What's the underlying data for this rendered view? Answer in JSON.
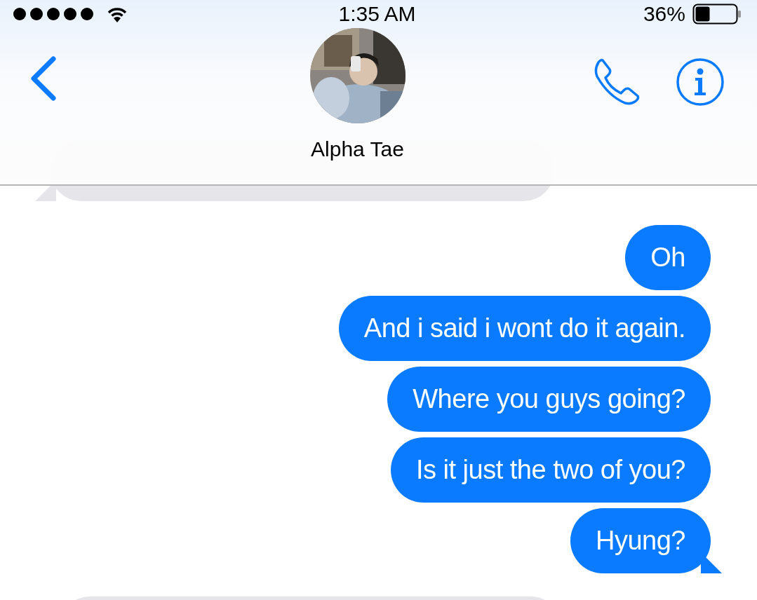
{
  "status_bar": {
    "time": "1:35 AM",
    "battery": "36%"
  },
  "header": {
    "contact_name": "Alpha Tae"
  },
  "messages": [
    {
      "kind": "incoming",
      "tail": true
    },
    {
      "kind": "outgoing",
      "text": "Oh",
      "tail": false
    },
    {
      "kind": "outgoing",
      "text": "And i said i wont do it again.",
      "tail": false
    },
    {
      "kind": "outgoing",
      "text": "Where you guys going?",
      "tail": false
    },
    {
      "kind": "outgoing",
      "text": "Is it just the two of you?",
      "tail": false
    },
    {
      "kind": "outgoing",
      "text": "Hyung?",
      "tail": true
    },
    {
      "kind": "incoming"
    }
  ]
}
